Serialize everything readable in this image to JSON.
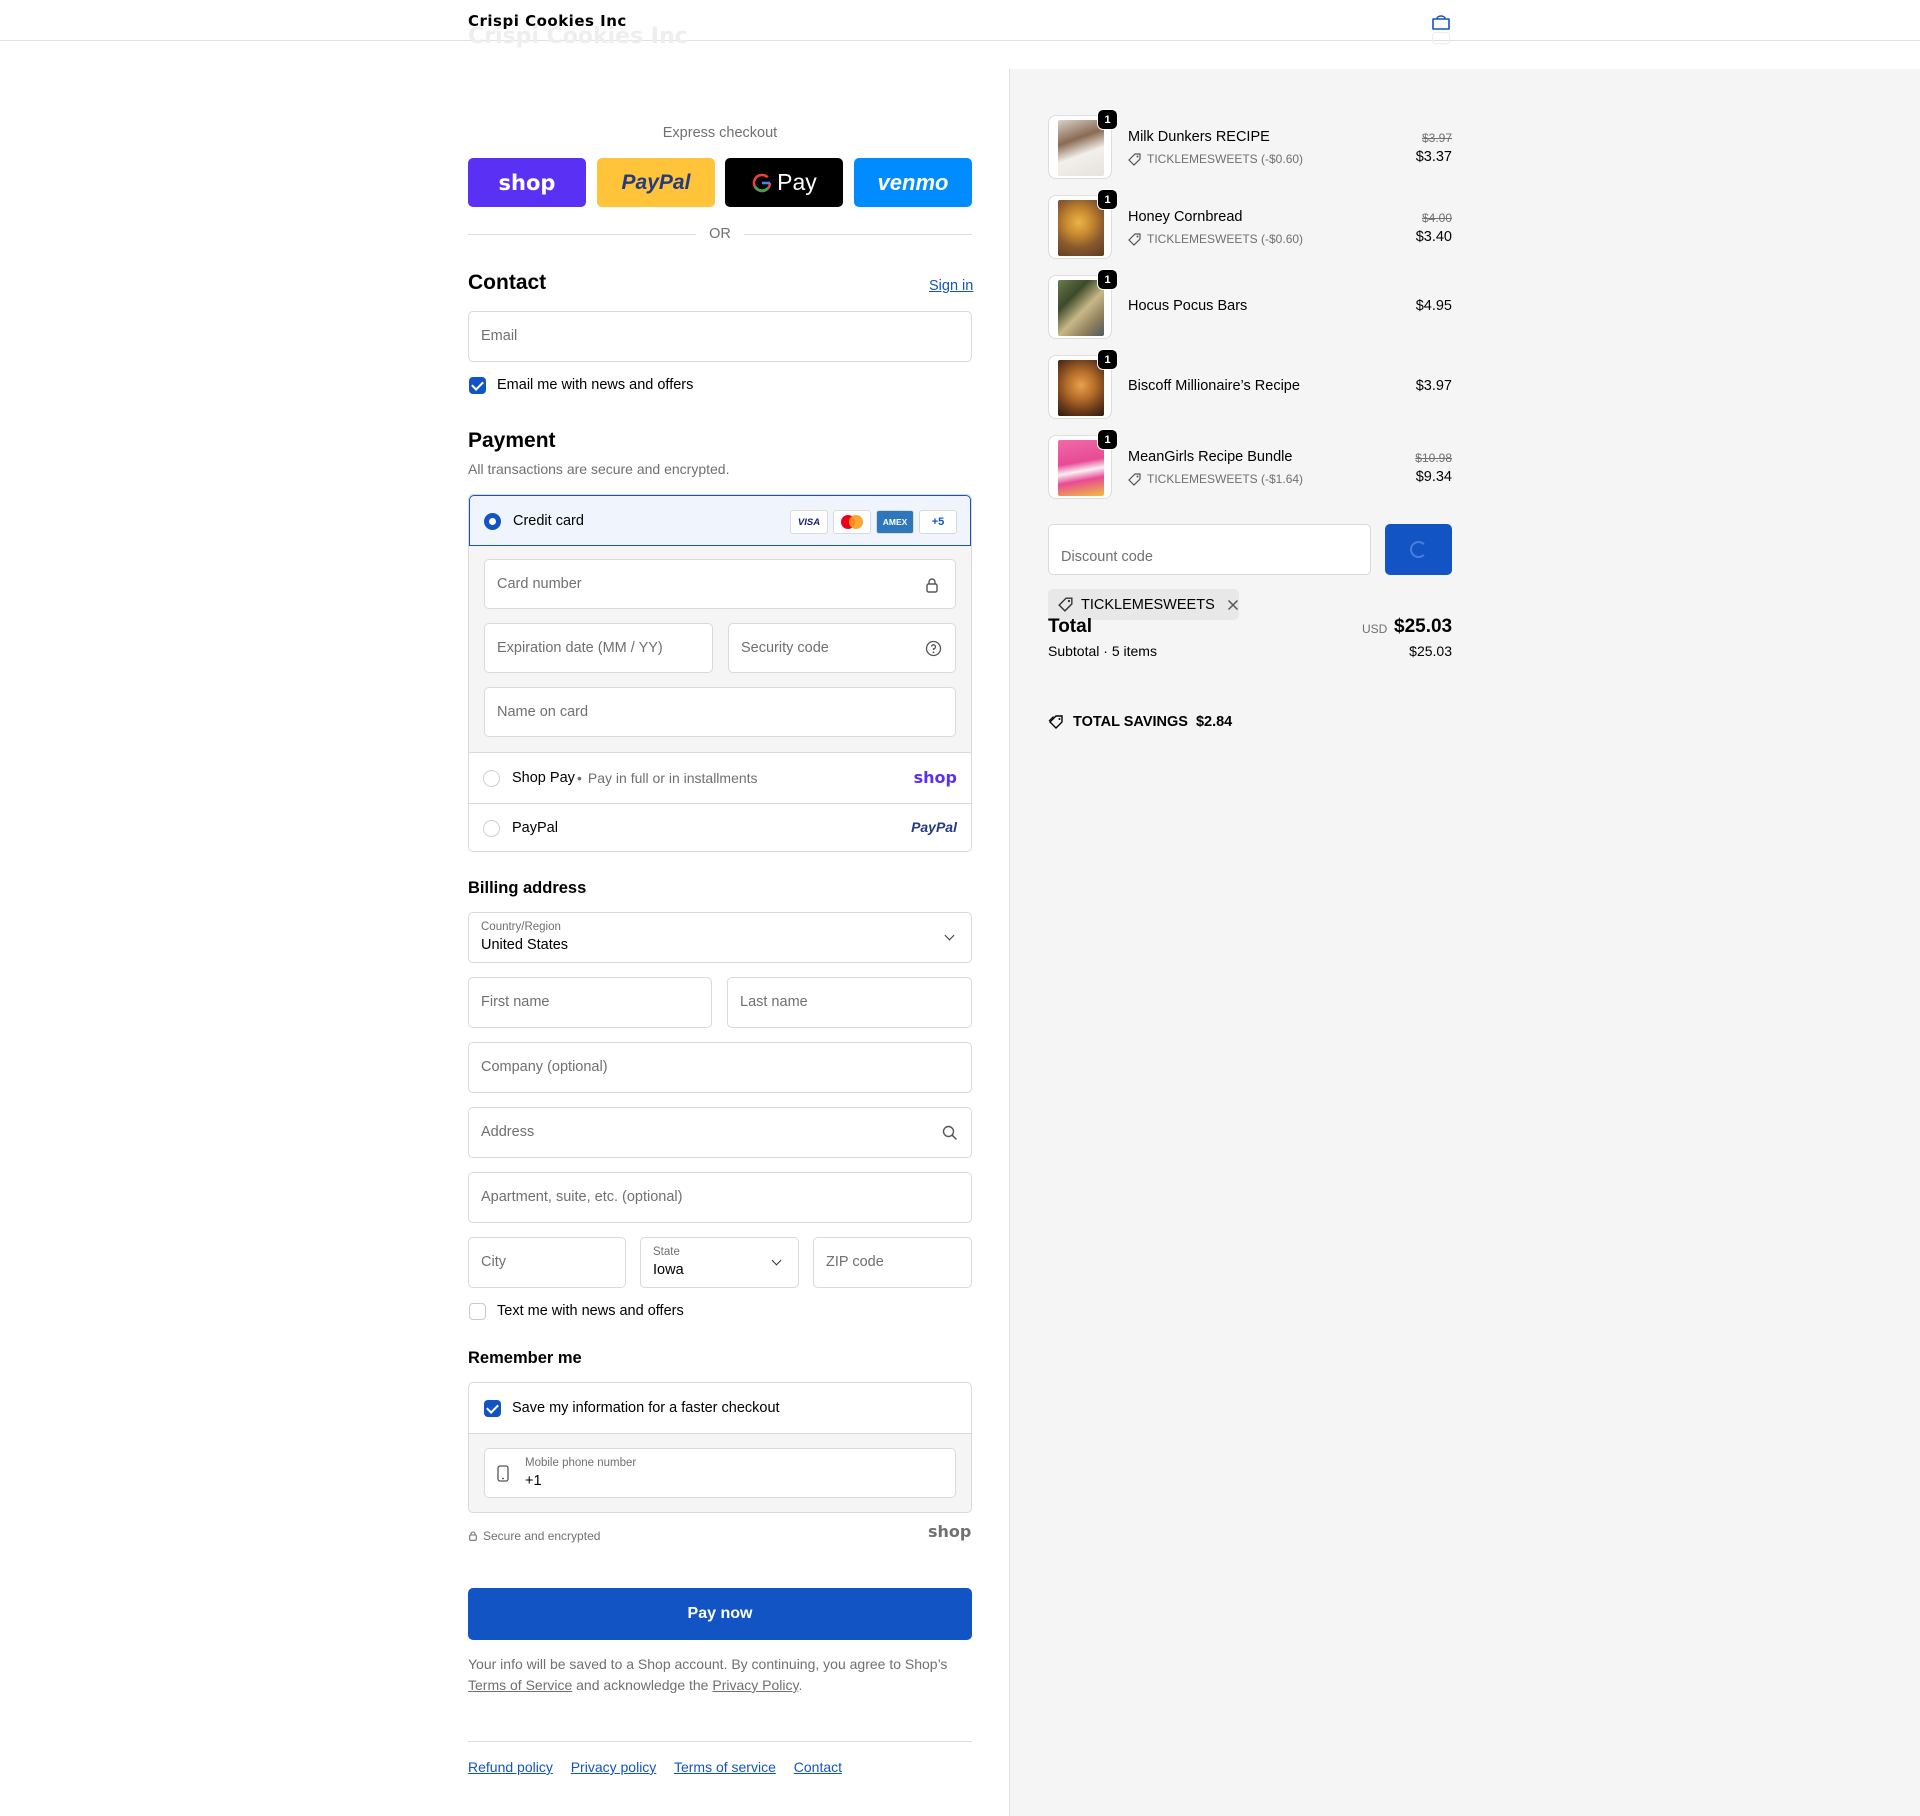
{
  "store": {
    "name": "Crispi Cookies Inc"
  },
  "express": {
    "label": "Express checkout",
    "buttons": [
      {
        "name": "shop",
        "label": "shop",
        "color": "#5a31f4"
      },
      {
        "name": "paypal",
        "label": "PayPal",
        "color": "#ffc439"
      },
      {
        "name": "gpay",
        "label": "Pay",
        "color": "#000000"
      },
      {
        "name": "venmo",
        "label": "venmo",
        "color": "#008cff"
      }
    ],
    "or": "OR"
  },
  "contact": {
    "title": "Contact",
    "sign_in": "Sign in",
    "email_placeholder": "Email",
    "newsletter": "Email me with news and offers",
    "newsletter_checked": true
  },
  "payment": {
    "title": "Payment",
    "subtitle": "All transactions are secure and encrypted.",
    "credit_card": "Credit card",
    "card_brands": [
      "VISA",
      "mastercard",
      "AMEX",
      "+5"
    ],
    "card_number": "Card number",
    "expiration": "Expiration date (MM / YY)",
    "security_code": "Security code",
    "name_on_card": "Name on card",
    "shop_pay": "Shop Pay",
    "shop_pay_sub": "Pay in full or in installments",
    "shop_logo": "shop",
    "paypal": "PayPal",
    "paypal_logo": "PayPal"
  },
  "billing": {
    "title": "Billing address",
    "country_label": "Country/Region",
    "country_value": "United States",
    "first_name": "First name",
    "last_name": "Last name",
    "company": "Company (optional)",
    "address": "Address",
    "apartment": "Apartment, suite, etc. (optional)",
    "city": "City",
    "state_label": "State",
    "state_value": "Iowa",
    "zip": "ZIP code",
    "text_me": "Text me with news and offers",
    "text_me_checked": false
  },
  "remember": {
    "title": "Remember me",
    "save_info": "Save my information for a faster checkout",
    "save_checked": true,
    "phone_label": "Mobile phone number",
    "phone_value": "+1",
    "secure": "Secure and encrypted",
    "shop_logo": "shop"
  },
  "pay_now": "Pay now",
  "legal": {
    "text1": "Your info will be saved to a Shop account. By continuing, you agree to Shop’s",
    "terms": "Terms of Service",
    "text2": "and acknowledge the",
    "privacy": "Privacy Policy",
    "text3": "."
  },
  "footer": [
    "Refund policy",
    "Privacy policy",
    "Terms of service",
    "Contact"
  ],
  "cart": {
    "items": [
      {
        "name": "Milk Dunkers RECIPE",
        "qty": "1",
        "discount": "TICKLEMESWEETS (-$0.60)",
        "old_price": "$3.97",
        "price": "$3.37"
      },
      {
        "name": "Honey Cornbread",
        "qty": "1",
        "discount": "TICKLEMESWEETS (-$0.60)",
        "old_price": "$4.00",
        "price": "$3.40"
      },
      {
        "name": "Hocus Pocus Bars",
        "qty": "1",
        "discount": "",
        "old_price": "",
        "price": "$4.95"
      },
      {
        "name": "Biscoff Millionaire’s Recipe",
        "qty": "1",
        "discount": "",
        "old_price": "",
        "price": "$3.97"
      },
      {
        "name": "MeanGirls Recipe Bundle",
        "qty": "1",
        "discount": "TICKLEMESWEETS (-$1.64)",
        "old_price": "$10.98",
        "price": "$9.34"
      }
    ],
    "discount_placeholder": "Discount code",
    "applied_code": "TICKLEMESWEETS",
    "total_label": "Total",
    "currency": "USD",
    "total": "$25.03",
    "subtotal_label": "Subtotal · 5 items",
    "subtotal": "$25.03",
    "savings_label": "TOTAL SAVINGS",
    "savings": "$2.84"
  },
  "colors": {
    "accent": "#1354c4",
    "sidebar_bg": "#f5f5f5"
  }
}
